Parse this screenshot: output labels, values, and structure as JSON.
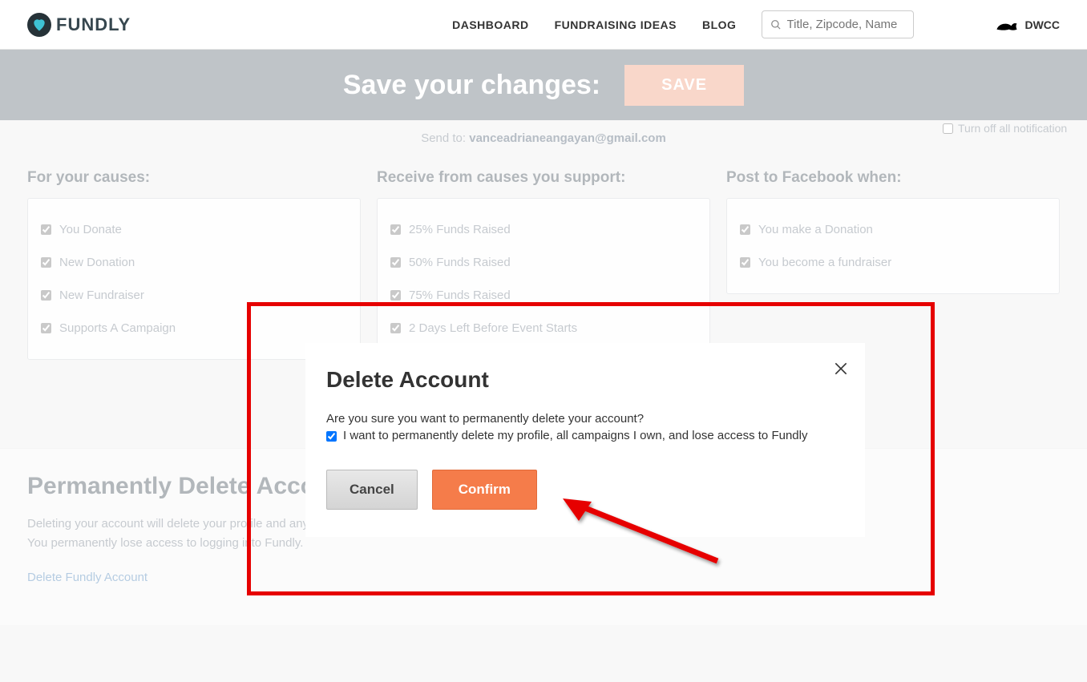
{
  "header": {
    "logo_text": "FUNDLY",
    "nav": {
      "dashboard": "DASHBOARD",
      "ideas": "FUNDRAISING IDEAS",
      "blog": "BLOG"
    },
    "search_placeholder": "Title, Zipcode, Name",
    "user_name": "DWCC"
  },
  "save_bar": {
    "text": "Save your changes:",
    "button": "SAVE"
  },
  "email_notice": {
    "prefix": "Send to: ",
    "email": "vanceadrianeangayan@gmail.com"
  },
  "turn_off_label": "Turn off all notification",
  "columns": {
    "causes": {
      "title": "For your causes:",
      "items": [
        "You Donate",
        "New Donation",
        "New Fundraiser",
        "Supports A Campaign"
      ]
    },
    "receive": {
      "title": "Receive from causes you support:",
      "items": [
        "25% Funds Raised",
        "50% Funds Raised",
        "75% Funds Raised",
        "2 Days Left Before Event Starts"
      ]
    },
    "facebook": {
      "title": "Post to Facebook when:",
      "items": [
        "You make a Donation",
        "You become a fundraiser"
      ]
    }
  },
  "delete_section": {
    "title": "Permanently Delete Account",
    "line1": "Deleting your account will delete your profile and any campaign pages you have created.",
    "line2": "You permanently lose access to logging into Fundly.",
    "link": "Delete Fundly Account"
  },
  "modal": {
    "title": "Delete Account",
    "question": "Are you sure you want to permanently delete your account?",
    "checkbox_label": "I want to permanently delete my profile, all campaigns I own, and lose access to Fundly",
    "cancel": "Cancel",
    "confirm": "Confirm"
  }
}
